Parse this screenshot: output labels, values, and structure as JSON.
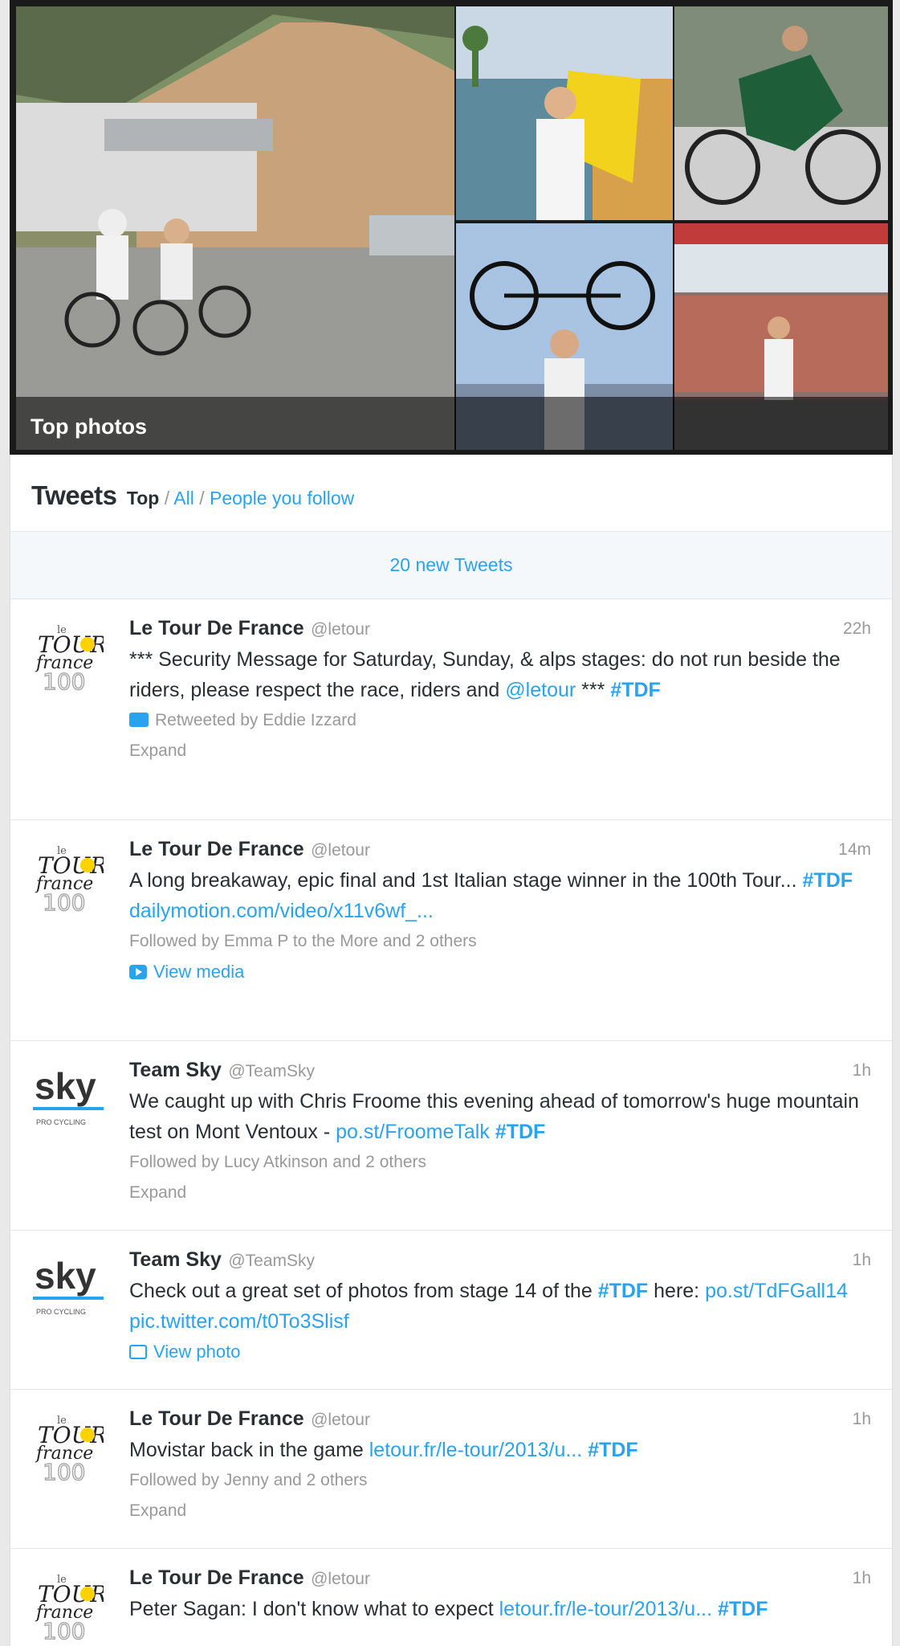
{
  "photos": {
    "label": "Top photos"
  },
  "timeline": {
    "title": "Tweets",
    "filters": {
      "current": "Top",
      "sep1": " / ",
      "all": "All",
      "sep2": " / ",
      "following": "People you follow"
    },
    "new_tweets": "20 new Tweets"
  },
  "tweets": [
    {
      "name": "Le Tour De France",
      "handle": "@letour",
      "time": "22h",
      "avatar": "tdf-100-logo",
      "text": "*** Security Message for Saturday, Sunday, & alps stages: do not run beside the riders, please respect the race, riders and ",
      "mention": "@letour",
      "text2": " *** ",
      "hashtag": "#TDF",
      "context": "Retweeted by Eddie Izzard",
      "action": "Expand"
    },
    {
      "name": "Le Tour De France",
      "handle": "@letour",
      "time": "14m",
      "avatar": "tdf-100-logo",
      "text": "A long breakaway, epic final and 1st Italian stage winner in the 100th Tour... ",
      "hashtag": "#TDF",
      "link": "dailymotion.com/video/x11v6wf_...",
      "context": "Followed by Emma P to the More and 2 others",
      "action": "View media"
    },
    {
      "name": "Team Sky",
      "handle": "@TeamSky",
      "time": "1h",
      "avatar": "team-sky-logo",
      "text": "We caught up with Chris Froome this evening ahead of tomorrow's huge mountain test on Mont Ventoux - ",
      "link": "po.st/FroomeTalk",
      "hashtag": "#TDF",
      "context": "Followed by Lucy Atkinson and 2 others",
      "action": "Expand"
    },
    {
      "name": "Team Sky",
      "handle": "@TeamSky",
      "time": "1h",
      "avatar": "team-sky-logo",
      "text": "Check out a great set of photos from stage 14 of the ",
      "hashtag": "#TDF",
      "text2": " here: ",
      "link": "po.st/TdFGall14",
      "link2": "pic.twitter.com/t0To3Slisf",
      "action": "View photo"
    },
    {
      "name": "Le Tour De France",
      "handle": "@letour",
      "time": "1h",
      "avatar": "tdf-100-logo",
      "text": "Movistar back in the game ",
      "link": "letour.fr/le-tour/2013/u...",
      "hashtag": "#TDF",
      "context": "Followed by Jenny and 2 others",
      "action": "Expand"
    },
    {
      "name": "Le Tour De France",
      "handle": "@letour",
      "time": "1h",
      "avatar": "tdf-100-logo",
      "text": "Peter Sagan: I don't know what to expect ",
      "link": "letour.fr/le-tour/2013/u...",
      "hashtag": "#TDF"
    }
  ],
  "colors": {
    "link": "#2aa3ef",
    "sky_blue": "#2aa3ef",
    "tdf_yellow": "#ffd200"
  }
}
